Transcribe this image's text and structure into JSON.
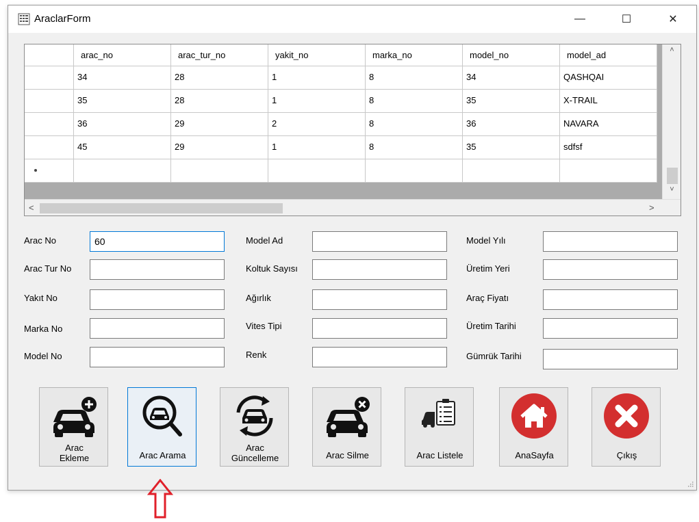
{
  "window": {
    "title": "AraclarForm",
    "minimize": "—",
    "maximize": "☐",
    "close": "✕"
  },
  "grid": {
    "columns": [
      "arac_no",
      "arac_tur_no",
      "yakit_no",
      "marka_no",
      "model_no",
      "model_ad"
    ],
    "rows": [
      [
        "34",
        "28",
        "1",
        "8",
        "34",
        "QASHQAI"
      ],
      [
        "35",
        "28",
        "1",
        "8",
        "35",
        "X-TRAIL"
      ],
      [
        "36",
        "29",
        "2",
        "8",
        "36",
        "NAVARA"
      ],
      [
        "45",
        "29",
        "1",
        "8",
        "35",
        "sdfsf"
      ]
    ],
    "scroll_up": "˄",
    "scroll_down": "˅",
    "scroll_left": "<",
    "scroll_right": ">"
  },
  "form": {
    "labels": {
      "arac_no": "Arac No",
      "arac_tur_no": "Arac Tur No",
      "yakit_no": "Yakıt No",
      "marka_no": "Marka No",
      "model_no": "Model No",
      "model_ad": "Model Ad",
      "koltuk_sayisi": "Koltuk Sayısı",
      "agirlik": "Ağırlık",
      "vites_tipi": "Vites Tipi",
      "renk": "Renk",
      "model_yili": "Model Yılı",
      "uretim_yeri": "Üretim Yeri",
      "arac_fiyati": "Araç Fiyatı",
      "uretim_tarihi": "Üretim Tarihi",
      "gumruk_tarihi": "Gümrük Tarihi"
    },
    "values": {
      "arac_no": "60",
      "arac_tur_no": "",
      "yakit_no": "",
      "marka_no": "",
      "model_no": "",
      "model_ad": "",
      "koltuk_sayisi": "",
      "agirlik": "",
      "vites_tipi": "",
      "renk": "",
      "model_yili": "",
      "uretim_yeri": "",
      "arac_fiyati": "",
      "uretim_tarihi": "",
      "gumruk_tarihi": ""
    }
  },
  "buttons": {
    "ekleme_line1": "Arac",
    "ekleme_line2": "Ekleme",
    "arama": "Arac Arama",
    "guncelleme_line1": "Arac",
    "guncelleme_line2": "Güncelleme",
    "silme": "Arac Silme",
    "listele": "Arac Listele",
    "anasayfa": "AnaSayfa",
    "cikis": "Çıkış"
  },
  "colors": {
    "accent_blue": "#0078d7",
    "red_icon": "#d32f2f",
    "annotation_arrow": "#e0202a"
  },
  "icons": {
    "app": "grid-icon",
    "ekleme": "car-add-icon",
    "arama": "car-search-icon",
    "guncelleme": "car-refresh-icon",
    "silme": "car-remove-icon",
    "listele": "car-list-icon",
    "anasayfa": "home-icon",
    "cikis": "close-circle-icon"
  }
}
